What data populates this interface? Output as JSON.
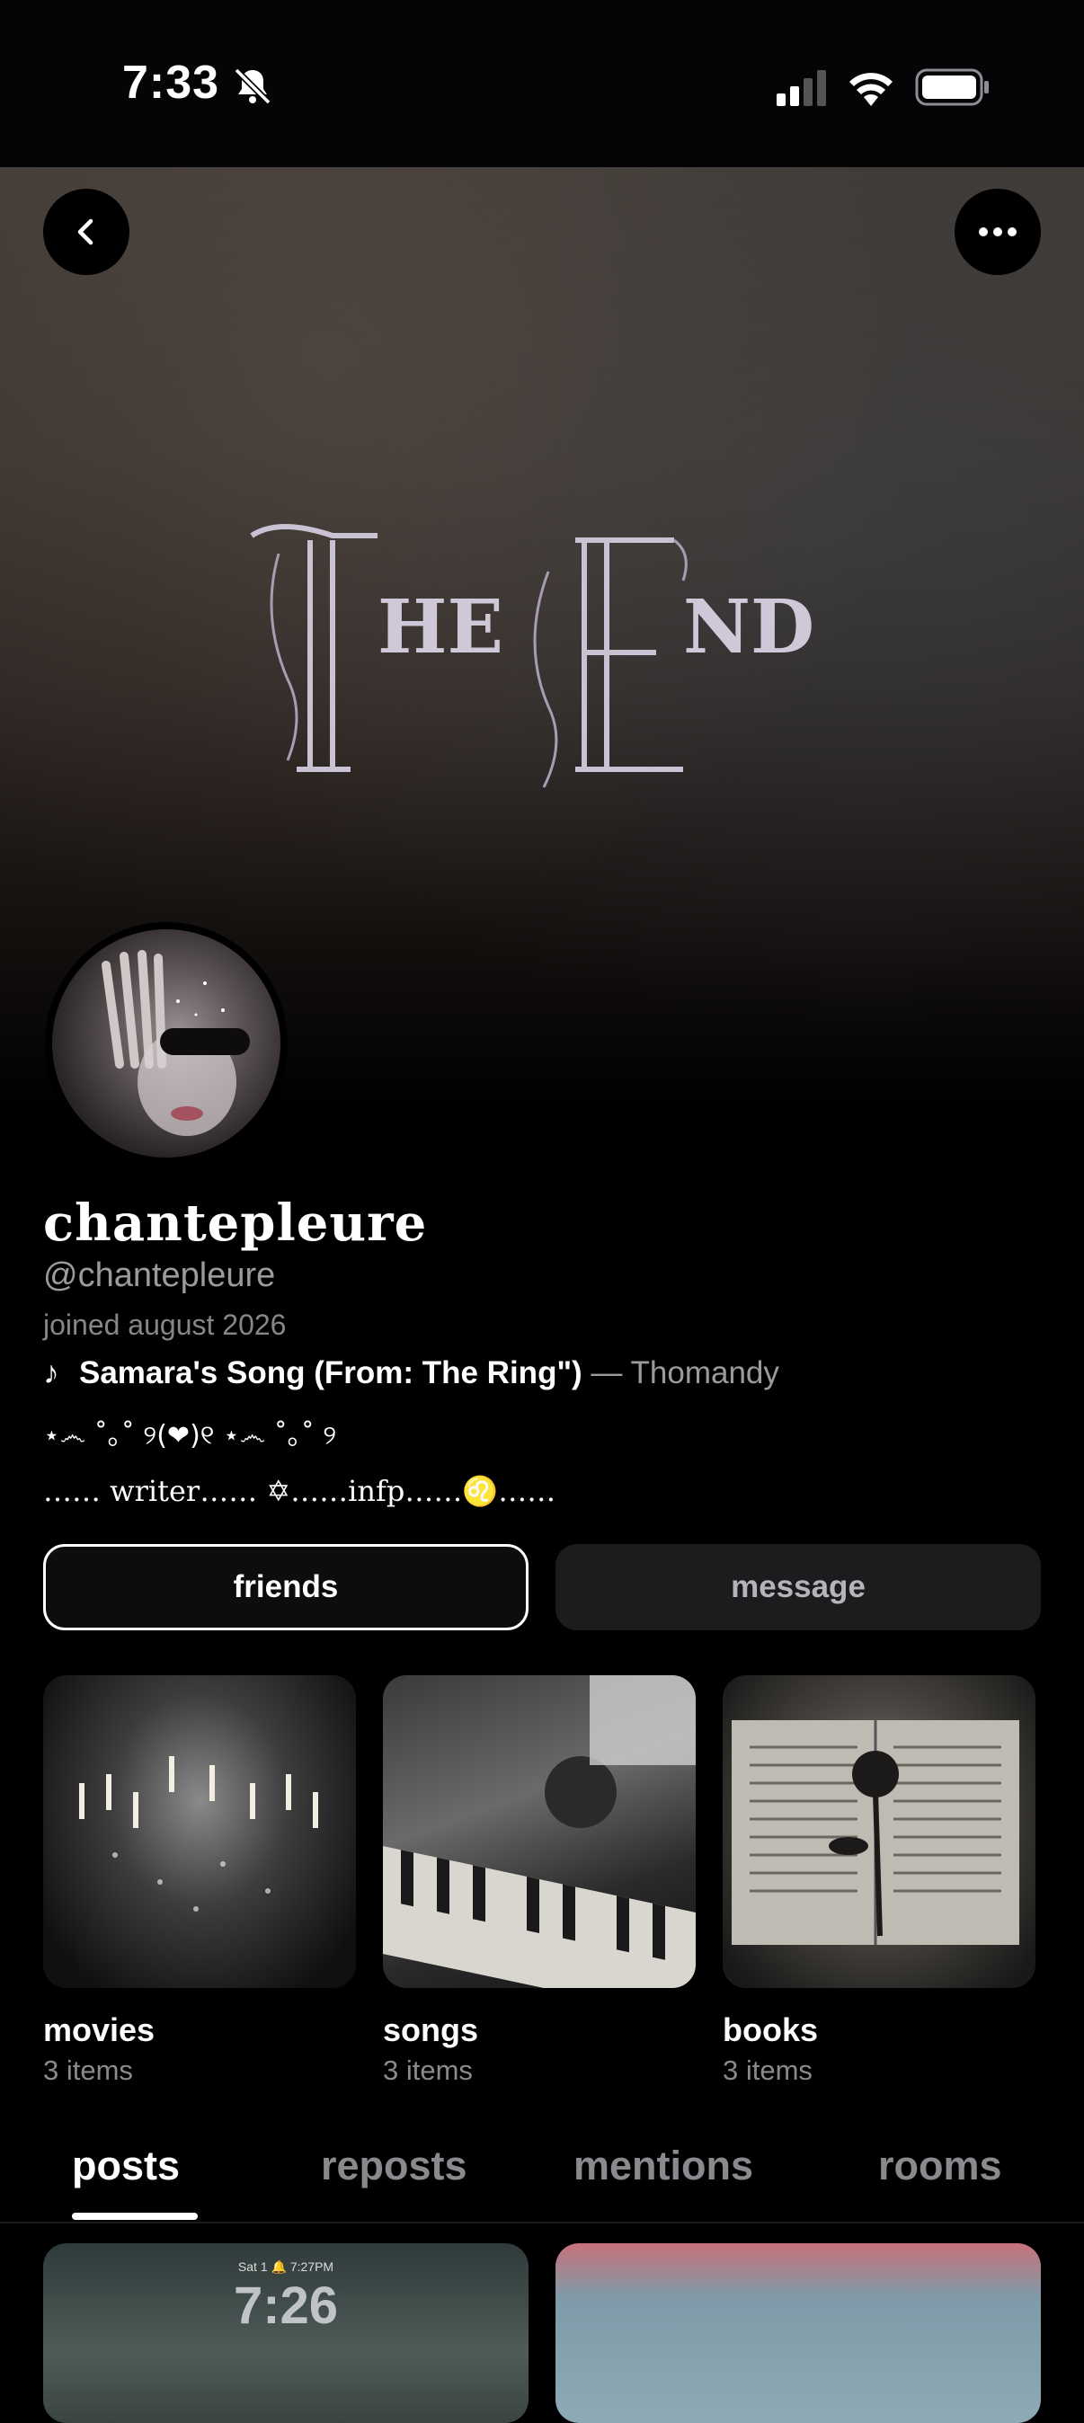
{
  "status_bar": {
    "time": "7:33"
  },
  "banner": {
    "art_text": "The End"
  },
  "profile": {
    "display_name": "chantepleure",
    "handle": "@chantepleure",
    "joined": "joined august 2026",
    "song_title": "Samara's Song (From: The Ring\")",
    "song_artist": " — Thomandy",
    "deco_line": "⋆෴ ˚｡˚ ୨(❤)୧ ⋆෴ ˚｡˚ ୨",
    "bio_line": "…… writer…… ✡……infp……♌……"
  },
  "actions": {
    "friends_label": "friends",
    "message_label": "message"
  },
  "collections": [
    {
      "title": "movies",
      "count": "3 items"
    },
    {
      "title": "songs",
      "count": "3 items"
    },
    {
      "title": "books",
      "count": "3 items"
    }
  ],
  "tabs": [
    "posts",
    "reposts",
    "mentions",
    "rooms"
  ],
  "posts": [
    {
      "time_text": "7:26",
      "date_text": "Sat 1 🔔 7:27PM"
    }
  ],
  "colors": {
    "background": "#000000",
    "muted_text": "#9b9b9f",
    "message_button": "#1c1c1e"
  }
}
